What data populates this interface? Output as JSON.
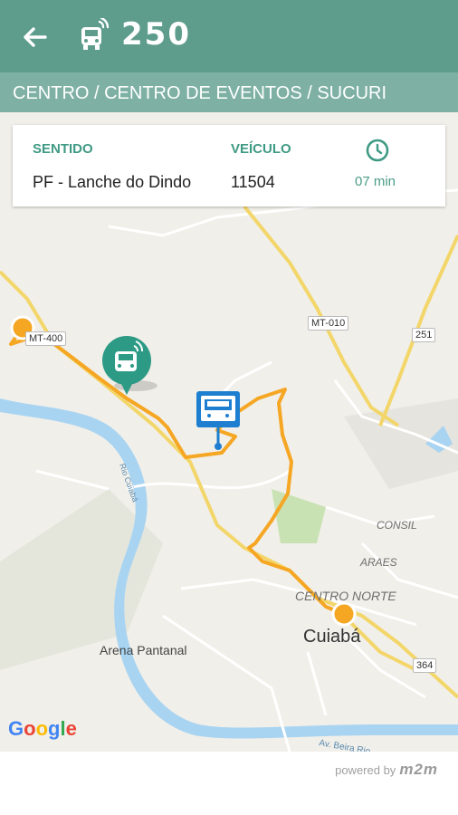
{
  "header": {
    "route_number": "250",
    "back_icon": "arrow-left-icon",
    "bus_icon": "bus-live-icon"
  },
  "route": {
    "name": "CENTRO / CENTRO DE EVENTOS / SUCURI"
  },
  "info_card": {
    "direction_label": "SENTIDO",
    "direction_value": "PF - Lanche do Dindo",
    "vehicle_label": "VEÍCULO",
    "vehicle_value": "11504",
    "eta_icon": "clock-icon",
    "eta_value": "07 min"
  },
  "map": {
    "labels": {
      "mt400": "MT-400",
      "mt010": "MT-010",
      "br251": "251",
      "br364": "364",
      "consil": "CONSIL",
      "araes": "ARAES",
      "centro_norte": "CENTRO NORTE",
      "cuiaba": "Cuiabá",
      "arena": "Arena Pantanal",
      "rio": "Rio Cuiabá",
      "av_beira": "Av. Beira Rio"
    },
    "colors": {
      "route": "#f5a623",
      "water": "#a8d4f2",
      "road": "#f3d66a",
      "land": "#f1efe9"
    }
  },
  "footer": {
    "powered_by": "powered by",
    "brand": "m2m",
    "google": "Google"
  }
}
